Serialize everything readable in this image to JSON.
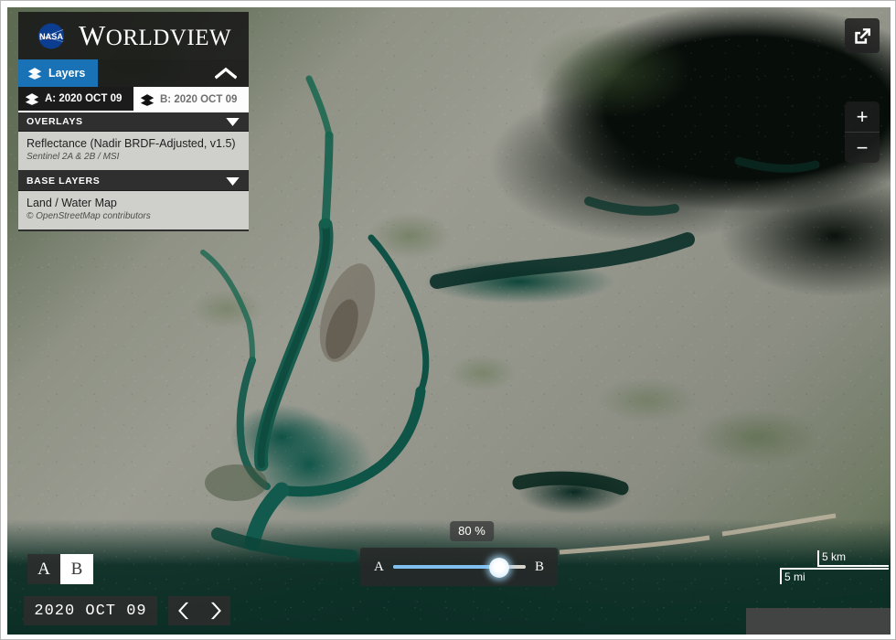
{
  "app": {
    "brand_agency": "NASA",
    "brand_name_cap": "W",
    "brand_name_rest": "ORLDVIEW",
    "logo_icon": "nasa-meatball-logo"
  },
  "layers_panel": {
    "tab_label": "Layers",
    "tab_icon": "layers-stack-icon",
    "collapse_icon": "chevron-up-icon",
    "accent_color": "#1972b5",
    "ab_tabs": [
      {
        "label": "A: 2020 OCT 09",
        "icon": "layers-stack-icon",
        "active": true
      },
      {
        "label": "B: 2020 OCT 09",
        "icon": "layers-stack-icon",
        "active": false
      }
    ],
    "groups": [
      {
        "heading": "OVERLAYS",
        "toggle_icon": "caret-down-icon",
        "layers": [
          {
            "title": "Reflectance (Nadir BRDF-Adjusted, v1.5)",
            "subtitle": "Sentinel 2A & 2B / MSI"
          }
        ]
      },
      {
        "heading": "BASE LAYERS",
        "toggle_icon": "caret-down-icon",
        "layers": [
          {
            "title": "Land / Water Map",
            "subtitle": "© OpenStreetMap contributors"
          }
        ]
      }
    ]
  },
  "map_controls": {
    "share_icon": "external-link-share-icon",
    "zoom_in_label": "+",
    "zoom_out_label": "−",
    "zoom_in_icon": "plus-icon",
    "zoom_out_icon": "minus-icon"
  },
  "ab_compare": {
    "left_label": "A",
    "right_label": "B",
    "value_label": "80 %",
    "value_percent": 80,
    "fill_color": "#7fc0ef",
    "rail_color": "#d7d3cd"
  },
  "ab_toggle": {
    "a_label": "A",
    "b_label": "B",
    "selected": "B"
  },
  "timeline": {
    "current_date": "2020 OCT 09",
    "prev_icon": "chevron-left-icon",
    "next_icon": "chevron-right-icon"
  },
  "scale": {
    "metric": "5 km",
    "imperial": "5 mi"
  }
}
